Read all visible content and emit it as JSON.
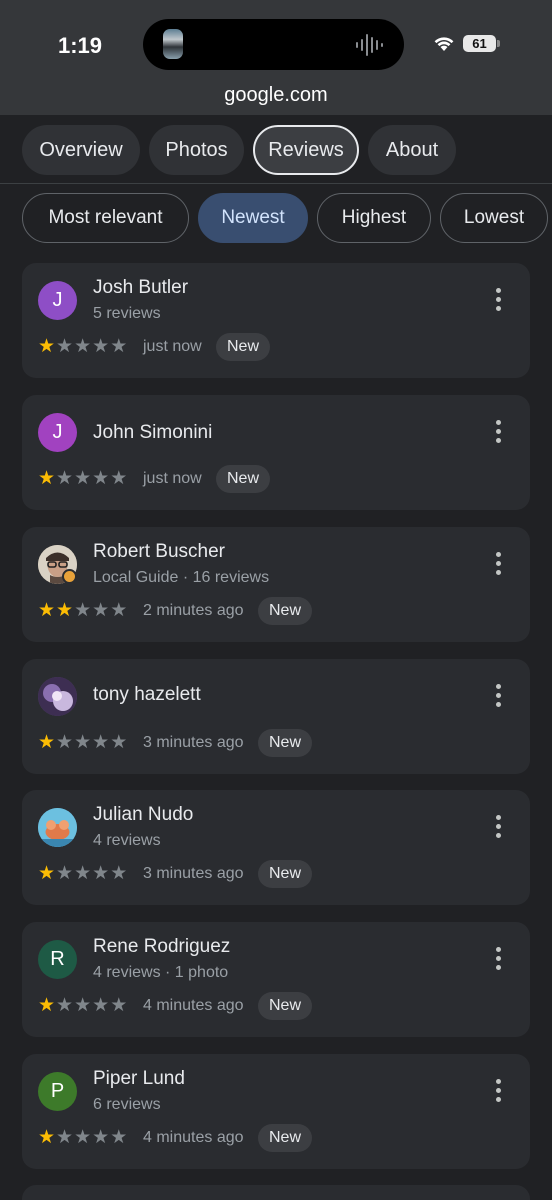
{
  "status_bar": {
    "time": "1:19",
    "battery": "61"
  },
  "browser": {
    "url": "google.com"
  },
  "tabs": [
    {
      "label": "Overview",
      "active": false
    },
    {
      "label": "Photos",
      "active": false
    },
    {
      "label": "Reviews",
      "active": true
    },
    {
      "label": "About",
      "active": false
    }
  ],
  "sort_chips": [
    {
      "label": "Most relevant",
      "active": false
    },
    {
      "label": "Newest",
      "active": true
    },
    {
      "label": "Highest",
      "active": false
    },
    {
      "label": "Lowest",
      "active": false
    }
  ],
  "reviews": [
    {
      "initial": "J",
      "avatar_color": "#8e4ec6",
      "name": "Josh Butler",
      "meta": "5 reviews",
      "rating": 1,
      "time": "just now",
      "badge": "New"
    },
    {
      "initial": "J",
      "avatar_color": "#a142c0",
      "name": "John Simonini",
      "meta": "",
      "rating": 1,
      "time": "just now",
      "badge": "New"
    },
    {
      "initial": "",
      "avatar_color": "#b9a890",
      "name": "Robert Buscher",
      "meta": "Local Guide · 16 reviews",
      "rating": 2,
      "time": "2 minutes ago",
      "badge": "New"
    },
    {
      "initial": "",
      "avatar_color": "#5b4a78",
      "name": "tony hazelett",
      "meta": "",
      "rating": 1,
      "time": "3 minutes ago",
      "badge": "New"
    },
    {
      "initial": "",
      "avatar_color": "#57a6c8",
      "name": "Julian Nudo",
      "meta": "4 reviews",
      "rating": 1,
      "time": "3 minutes ago",
      "badge": "New"
    },
    {
      "initial": "R",
      "avatar_color": "#1e5a45",
      "name": "Rene Rodriguez",
      "meta": "4 reviews · 1 photo",
      "rating": 1,
      "time": "4 minutes ago",
      "badge": "New"
    },
    {
      "initial": "P",
      "avatar_color": "#3d7a2a",
      "name": "Piper Lund",
      "meta": "6 reviews",
      "rating": 1,
      "time": "4 minutes ago",
      "badge": "New"
    }
  ]
}
